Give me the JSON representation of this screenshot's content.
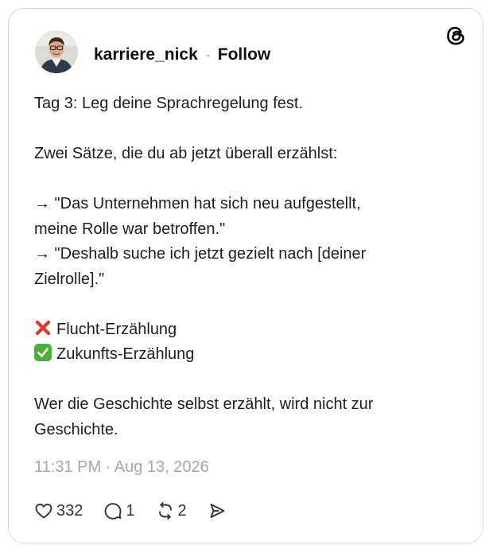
{
  "post": {
    "username": "karriere_nick",
    "separator": "·",
    "follow_label": "Follow",
    "lines": [
      "Tag 3: Leg deine Sprachregelung fest.",
      "",
      "Zwei Sätze, die du ab jetzt überall erzählst:",
      "",
      "→ \"Das Unternehmen hat sich neu aufgestellt,",
      "meine Rolle war betroffen.\"",
      "→ \"Deshalb suche ich jetzt gezielt nach [deiner",
      "Zielrolle].\"",
      "",
      "Flucht-Erzählung",
      "Zukunfts-Erzählung",
      "",
      "Wer die Geschichte selbst erzählt, wird nicht zur",
      "Geschichte."
    ],
    "timestamp": "11:31 PM · Aug 13, 2026",
    "actions": {
      "likes": "332",
      "replies": "1",
      "reposts": "2"
    }
  },
  "icons": {
    "logo": "threads-logo-icon",
    "like": "heart-icon",
    "reply": "speech-bubble-icon",
    "repost": "repost-icon",
    "share": "send-icon",
    "cross": "red-cross-emoji-icon",
    "check": "green-check-emoji-icon"
  },
  "colors": {
    "text": "#1e1e1e",
    "muted": "#a6a6a6",
    "border": "#d9d9d9",
    "cross_red": "#e0382e",
    "check_green": "#4caf3a"
  }
}
